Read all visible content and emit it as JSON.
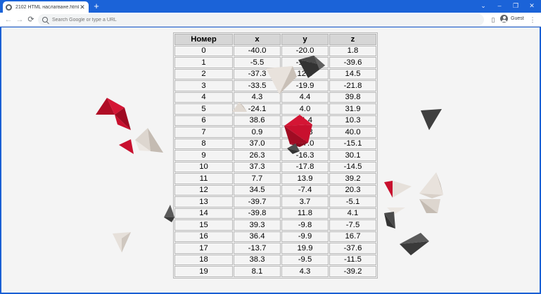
{
  "browser": {
    "tab_title": "2102 HTML наслагване.html",
    "tab_close": "✕",
    "new_tab": "+",
    "window_controls": [
      "⌄",
      "–",
      "❐",
      "✕"
    ],
    "back": "←",
    "forward": "→",
    "reload": "⟳",
    "address_placeholder": "Search Google or type a URL",
    "profile_label": "Guest",
    "menu": "⋮",
    "side_panel": "▯"
  },
  "table": {
    "headers": [
      "Номер",
      "x",
      "y",
      "z"
    ],
    "rows": [
      [
        "0",
        "-40.0",
        "-20.0",
        "1.8"
      ],
      [
        "1",
        "-5.5",
        "-16.9",
        "-39.6"
      ],
      [
        "2",
        "-37.3",
        "12.6",
        "14.5"
      ],
      [
        "3",
        "-33.5",
        "-19.9",
        "-21.8"
      ],
      [
        "4",
        "4.3",
        "4.4",
        "39.8"
      ],
      [
        "5",
        "-24.1",
        "4.0",
        "31.9"
      ],
      [
        "6",
        "38.6",
        "11.4",
        "10.3"
      ],
      [
        "7",
        "0.9",
        "12.8",
        "40.0"
      ],
      [
        "8",
        "37.0",
        "-17.0",
        "-15.1"
      ],
      [
        "9",
        "26.3",
        "-16.3",
        "30.1"
      ],
      [
        "10",
        "37.3",
        "-17.8",
        "-14.5"
      ],
      [
        "11",
        "7.7",
        "13.9",
        "39.2"
      ],
      [
        "12",
        "34.5",
        "-7.4",
        "20.3"
      ],
      [
        "13",
        "-39.7",
        "3.7",
        "-5.1"
      ],
      [
        "14",
        "-39.8",
        "11.8",
        "4.1"
      ],
      [
        "15",
        "39.3",
        "-9.8",
        "-7.5"
      ],
      [
        "16",
        "36.4",
        "-9.9",
        "16.7"
      ],
      [
        "17",
        "-13.7",
        "19.9",
        "-37.6"
      ],
      [
        "18",
        "38.3",
        "-9.5",
        "-11.5"
      ],
      [
        "19",
        "8.1",
        "4.3",
        "-39.2"
      ]
    ]
  },
  "colors": {
    "red": "#c8102e",
    "dark": "#4a4a4a",
    "cream": "#e8e2dc"
  }
}
